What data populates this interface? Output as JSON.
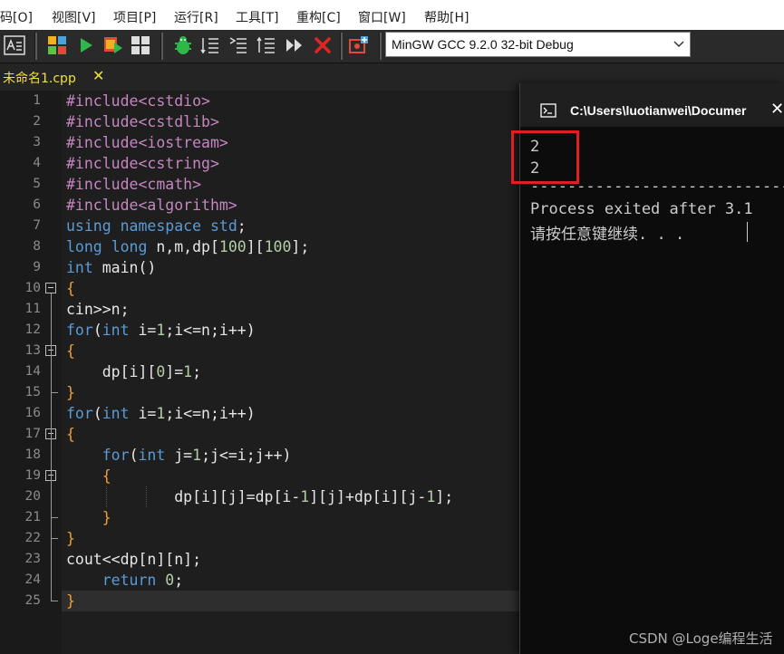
{
  "menu": [
    {
      "label": "码[O]"
    },
    {
      "label": "视图[V]"
    },
    {
      "label": "项目[P]"
    },
    {
      "label": "运行[R]"
    },
    {
      "label": "工具[T]"
    },
    {
      "label": "重构[C]"
    },
    {
      "label": "窗口[W]"
    },
    {
      "label": "帮助[H]"
    }
  ],
  "toolbar": {
    "compiler": "MinGW GCC 9.2.0 32-bit Debug",
    "icons": [
      "format-code-icon",
      "grid-icon",
      "run-icon",
      "compile-run-icon",
      "rebuild-icon",
      "debug-icon",
      "indent-icon",
      "unindent-icon",
      "toggle-comment-icon",
      "step-icon",
      "stop-icon",
      "profile-icon"
    ]
  },
  "tab": {
    "label": "未命名1.cpp",
    "close": "✕"
  },
  "editor": {
    "line_numbers": [
      "1",
      "2",
      "3",
      "4",
      "5",
      "6",
      "7",
      "8",
      "9",
      "10",
      "11",
      "12",
      "13",
      "14",
      "15",
      "16",
      "17",
      "18",
      "19",
      "20",
      "21",
      "22",
      "23",
      "24",
      "25"
    ],
    "lines": [
      "#include<cstdio>",
      "#include<cstdlib>",
      "#include<iostream>",
      "#include<cstring>",
      "#include<cmath>",
      "#include<algorithm>",
      "using namespace std;",
      "long long n,m,dp[100][100];",
      "int main()",
      "{",
      "cin>>n;",
      "for(int i=1;i<=n;i++)",
      "{",
      "    dp[i][0]=1;",
      "}",
      "for(int i=1;i<=n;i++)",
      "{",
      "    for(int j=1;j<=i;j++)",
      "    {",
      "            dp[i][j]=dp[i-1][j]+dp[i][j-1];",
      "    }",
      "}",
      "cout<<dp[n][n];",
      "    return 0;",
      "}"
    ]
  },
  "console": {
    "title": "C:\\Users\\luotianwei\\Documer",
    "output": [
      "2",
      "2"
    ],
    "separator": "--------------------------------",
    "process_line": "Process exited after 3.1",
    "prompt_line": "请按任意键继续. . ."
  },
  "watermark": "CSDN @Loge编程生活",
  "colors": {
    "preprocessor": "#c586c0",
    "keyword": "#5b9bd5",
    "number": "#b5cea8",
    "brace": "#f0a030",
    "highlight": "#e02020"
  }
}
